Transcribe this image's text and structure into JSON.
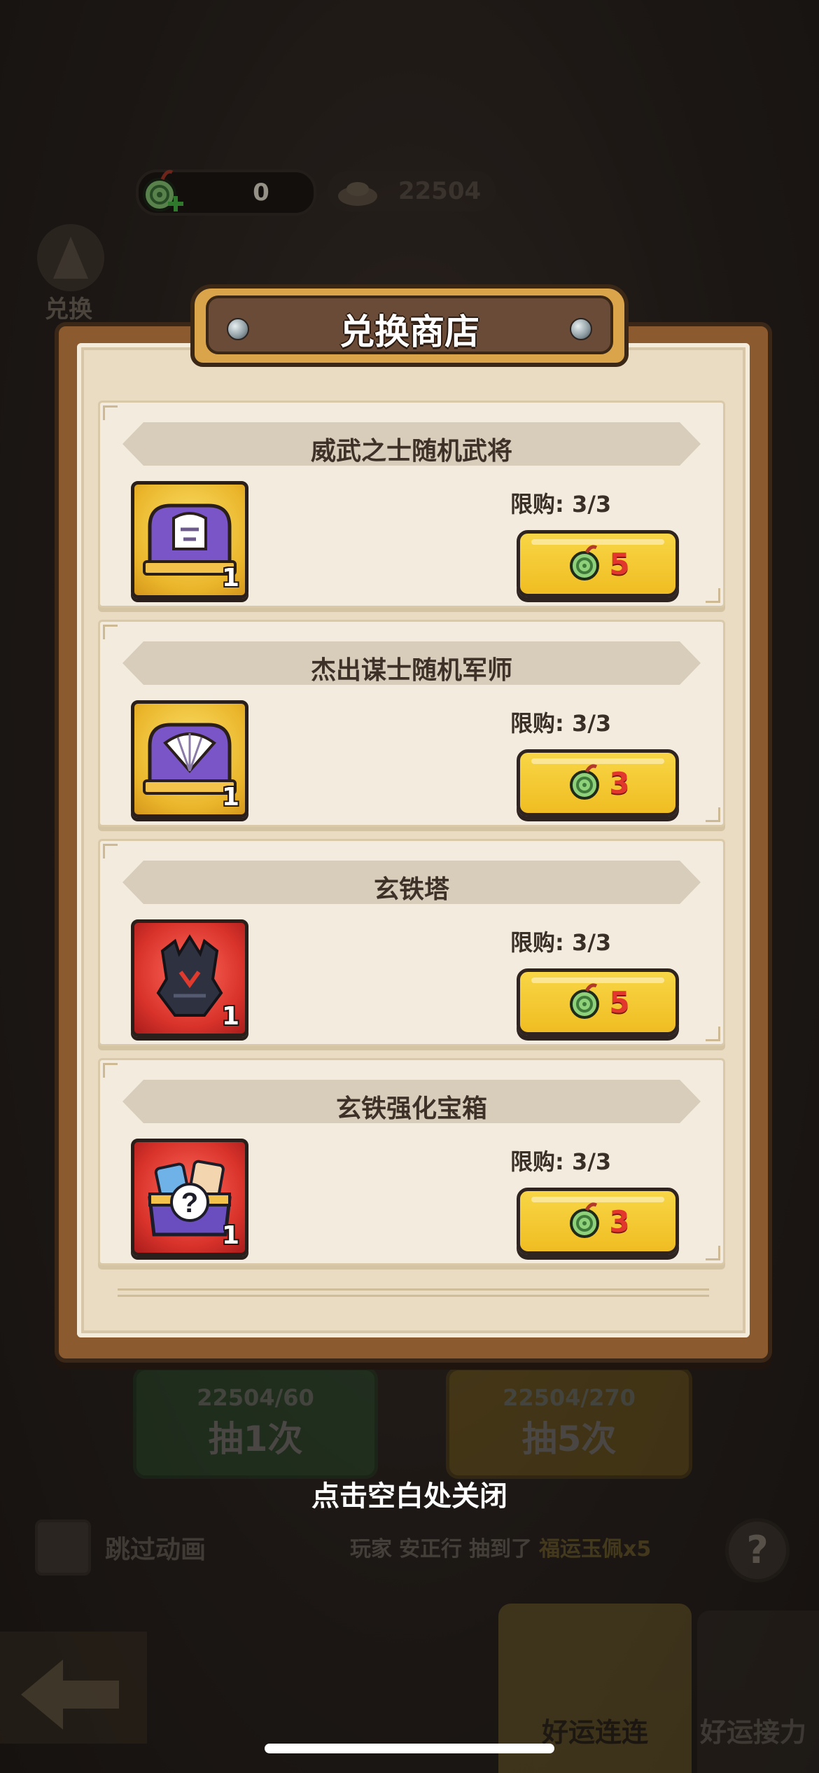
{
  "currency": {
    "jade_amount": "0",
    "gold_amount": "22504"
  },
  "background": {
    "exchange_label": "兑换",
    "draw_once": {
      "cost": "22504/60",
      "label": "抽1次"
    },
    "draw_five": {
      "cost": "22504/270",
      "label": "抽5次"
    },
    "skip_animation": "跳过动画",
    "ticker": {
      "prefix": "玩家",
      "player": "安正行",
      "middle": "抽到了",
      "reward": "福运玉佩x5"
    },
    "help": "?",
    "tabs": {
      "lucky_combo": "好运连连",
      "lucky_relay": "好运接力"
    }
  },
  "modal": {
    "title": "兑换商店",
    "items": [
      {
        "name": "威武之士随机武将",
        "limit": "限购: 3/3",
        "price": "5",
        "qty": "1",
        "icon": "purple-chest-helmet-icon"
      },
      {
        "name": "杰出谋士随机军师",
        "limit": "限购: 3/3",
        "price": "3",
        "qty": "1",
        "icon": "purple-chest-fan-icon"
      },
      {
        "name": "玄铁塔",
        "limit": "限购: 3/3",
        "price": "5",
        "qty": "1",
        "icon": "dark-iron-tower-icon"
      },
      {
        "name": "玄铁强化宝箱",
        "limit": "限购: 3/3",
        "price": "3",
        "qty": "1",
        "icon": "mystery-chest-icon"
      }
    ]
  },
  "close_hint": "点击空白处关闭",
  "colors": {
    "button_yellow": "#f0bd22",
    "price_red": "#e2372c",
    "frame_brown": "#8b5a2f",
    "card_bg": "#f2ebde"
  }
}
